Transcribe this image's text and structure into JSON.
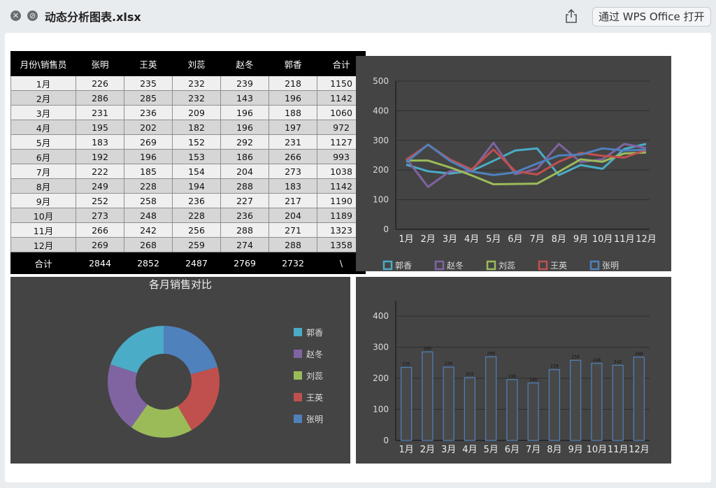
{
  "window": {
    "title": "动态分析图表.xlsx",
    "open_button": "通过 WPS Office 打开"
  },
  "table": {
    "headers": [
      "月份\\销售员",
      "张明",
      "王英",
      "刘蕊",
      "赵冬",
      "郭香",
      "合计"
    ],
    "rows": [
      [
        "1月",
        "226",
        "235",
        "232",
        "239",
        "218",
        "1150"
      ],
      [
        "2月",
        "286",
        "285",
        "232",
        "143",
        "196",
        "1142"
      ],
      [
        "3月",
        "231",
        "236",
        "209",
        "196",
        "188",
        "1060"
      ],
      [
        "4月",
        "195",
        "202",
        "182",
        "196",
        "197",
        "972"
      ],
      [
        "5月",
        "183",
        "269",
        "152",
        "292",
        "231",
        "1127"
      ],
      [
        "6月",
        "192",
        "196",
        "153",
        "186",
        "266",
        "993"
      ],
      [
        "7月",
        "222",
        "185",
        "154",
        "204",
        "273",
        "1038"
      ],
      [
        "8月",
        "249",
        "228",
        "194",
        "288",
        "183",
        "1142"
      ],
      [
        "9月",
        "252",
        "258",
        "236",
        "227",
        "217",
        "1190"
      ],
      [
        "10月",
        "273",
        "248",
        "228",
        "236",
        "204",
        "1189"
      ],
      [
        "11月",
        "266",
        "242",
        "256",
        "288",
        "271",
        "1323"
      ],
      [
        "12月",
        "269",
        "268",
        "259",
        "274",
        "288",
        "1358"
      ]
    ],
    "total": [
      "合计",
      "2844",
      "2852",
      "2487",
      "2769",
      "2732",
      "\\"
    ]
  },
  "colors": {
    "郭香": "#4aacc6",
    "赵冬": "#8064a2",
    "刘蕊": "#9bbb59",
    "王英": "#c0504d",
    "张明": "#4f81bd",
    "panel_bg": "#444444",
    "bar": "#4f81bd"
  },
  "chart_data": [
    {
      "type": "line",
      "categories": [
        "1月",
        "2月",
        "3月",
        "4月",
        "5月",
        "6月",
        "7月",
        "8月",
        "9月",
        "10月",
        "11月",
        "12月"
      ],
      "ylim": [
        0,
        500
      ],
      "yticks": [
        0,
        100,
        200,
        300,
        400,
        500
      ],
      "grid": true,
      "legend_position": "bottom",
      "series": [
        {
          "name": "郭香",
          "values": [
            218,
            196,
            188,
            197,
            231,
            266,
            273,
            183,
            217,
            204,
            271,
            288
          ]
        },
        {
          "name": "赵冬",
          "values": [
            239,
            143,
            196,
            196,
            292,
            186,
            204,
            288,
            227,
            236,
            288,
            274
          ]
        },
        {
          "name": "刘蕊",
          "values": [
            232,
            232,
            209,
            182,
            152,
            153,
            154,
            194,
            236,
            228,
            256,
            259
          ]
        },
        {
          "name": "王英",
          "values": [
            235,
            285,
            236,
            202,
            269,
            196,
            185,
            228,
            258,
            248,
            242,
            268
          ]
        },
        {
          "name": "张明",
          "values": [
            226,
            286,
            231,
            195,
            183,
            192,
            222,
            249,
            252,
            273,
            266,
            269
          ]
        }
      ]
    },
    {
      "type": "pie",
      "title": "各月销售对比",
      "legend_position": "right",
      "series": [
        {
          "name": "郭香",
          "value": 2732
        },
        {
          "name": "赵冬",
          "value": 2769
        },
        {
          "name": "刘蕊",
          "value": 2487
        },
        {
          "name": "王英",
          "value": 2852
        },
        {
          "name": "张明",
          "value": 2844
        }
      ]
    },
    {
      "type": "bar",
      "categories": [
        "1月",
        "2月",
        "3月",
        "4月",
        "5月",
        "6月",
        "7月",
        "8月",
        "9月",
        "10月",
        "11月",
        "12月"
      ],
      "values": [
        235,
        285,
        236,
        202,
        269,
        196,
        185,
        228,
        258,
        248,
        242,
        268
      ],
      "ylim": [
        0,
        450
      ],
      "yticks": [
        0,
        100,
        200,
        300,
        400
      ],
      "grid": true
    }
  ]
}
